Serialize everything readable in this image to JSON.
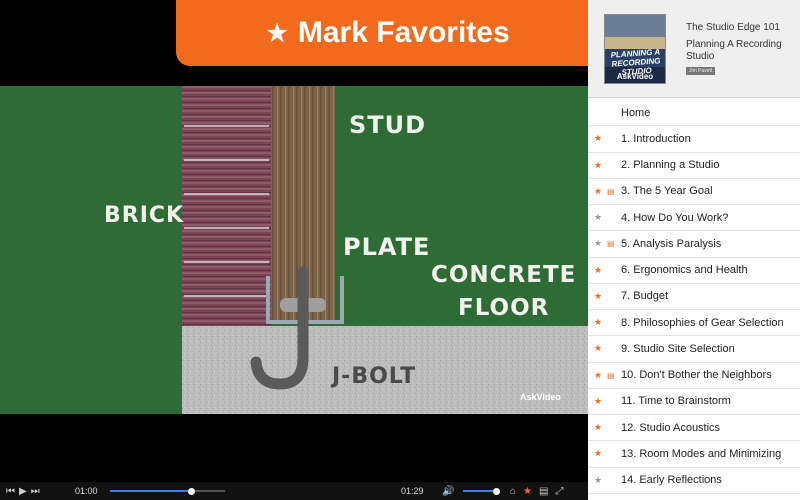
{
  "banner": {
    "star": "★",
    "title": "Mark Favorites"
  },
  "video": {
    "labels": {
      "brick": "BRICK",
      "stud": "STUD",
      "plate": "PLATE",
      "floor_line1": "CONCRETE",
      "floor_line2": "FLOOR",
      "jbolt": "J-BOLT"
    },
    "watermark": "AskVideo",
    "colors": {
      "chalkboard": "#2f6b34",
      "concrete": "#bdbdbd",
      "brick": "#7a4656",
      "wood": "#7a6247",
      "bolt": "#5a5a5a",
      "plate": "#9aa9b2"
    }
  },
  "player": {
    "rewind_icon": "rewind-icon",
    "play_icon": "play-icon",
    "forward_icon": "fast-forward-icon",
    "elapsed": "01:00",
    "duration": "01:29",
    "progress": 0.71,
    "volume": 0.9,
    "volume_icon": "speaker-icon",
    "home_icon": "home-icon",
    "favorite_icon": "star-icon",
    "notes_icon": "notes-icon",
    "fullscreen_icon": "fullscreen-icon"
  },
  "course": {
    "series": "The Studio Edge 101",
    "title": "Planning A Recording Studio",
    "author": "Jim Pavett",
    "thumb_title": "PLANNING A RECORDING STUDIO",
    "thumb_brand": "AskVideo"
  },
  "lessons": [
    {
      "label": "Home",
      "fav": "",
      "note": false
    },
    {
      "label": "1. Introduction",
      "fav": "on",
      "note": false
    },
    {
      "label": "2. Planning a Studio",
      "fav": "on",
      "note": false
    },
    {
      "label": "3. The 5 Year Goal",
      "fav": "on",
      "note": true
    },
    {
      "label": "4. How Do You Work?",
      "fav": "off",
      "note": false
    },
    {
      "label": "5. Analysis Paralysis",
      "fav": "off",
      "note": true
    },
    {
      "label": "6. Ergonomics and Health",
      "fav": "on",
      "note": false
    },
    {
      "label": "7. Budget",
      "fav": "on",
      "note": false
    },
    {
      "label": "8. Philosophies of Gear Selection",
      "fav": "on",
      "note": false
    },
    {
      "label": "9. Studio Site Selection",
      "fav": "on",
      "note": false
    },
    {
      "label": "10. Don't Bother the Neighbors",
      "fav": "on",
      "note": true
    },
    {
      "label": "11. Time to Brainstorm",
      "fav": "on",
      "note": false
    },
    {
      "label": "12. Studio Acoustics",
      "fav": "on",
      "note": false
    },
    {
      "label": "13. Room Modes and Minimizing",
      "fav": "on",
      "note": false
    },
    {
      "label": "14. Early Reflections",
      "fav": "off",
      "note": false
    }
  ]
}
